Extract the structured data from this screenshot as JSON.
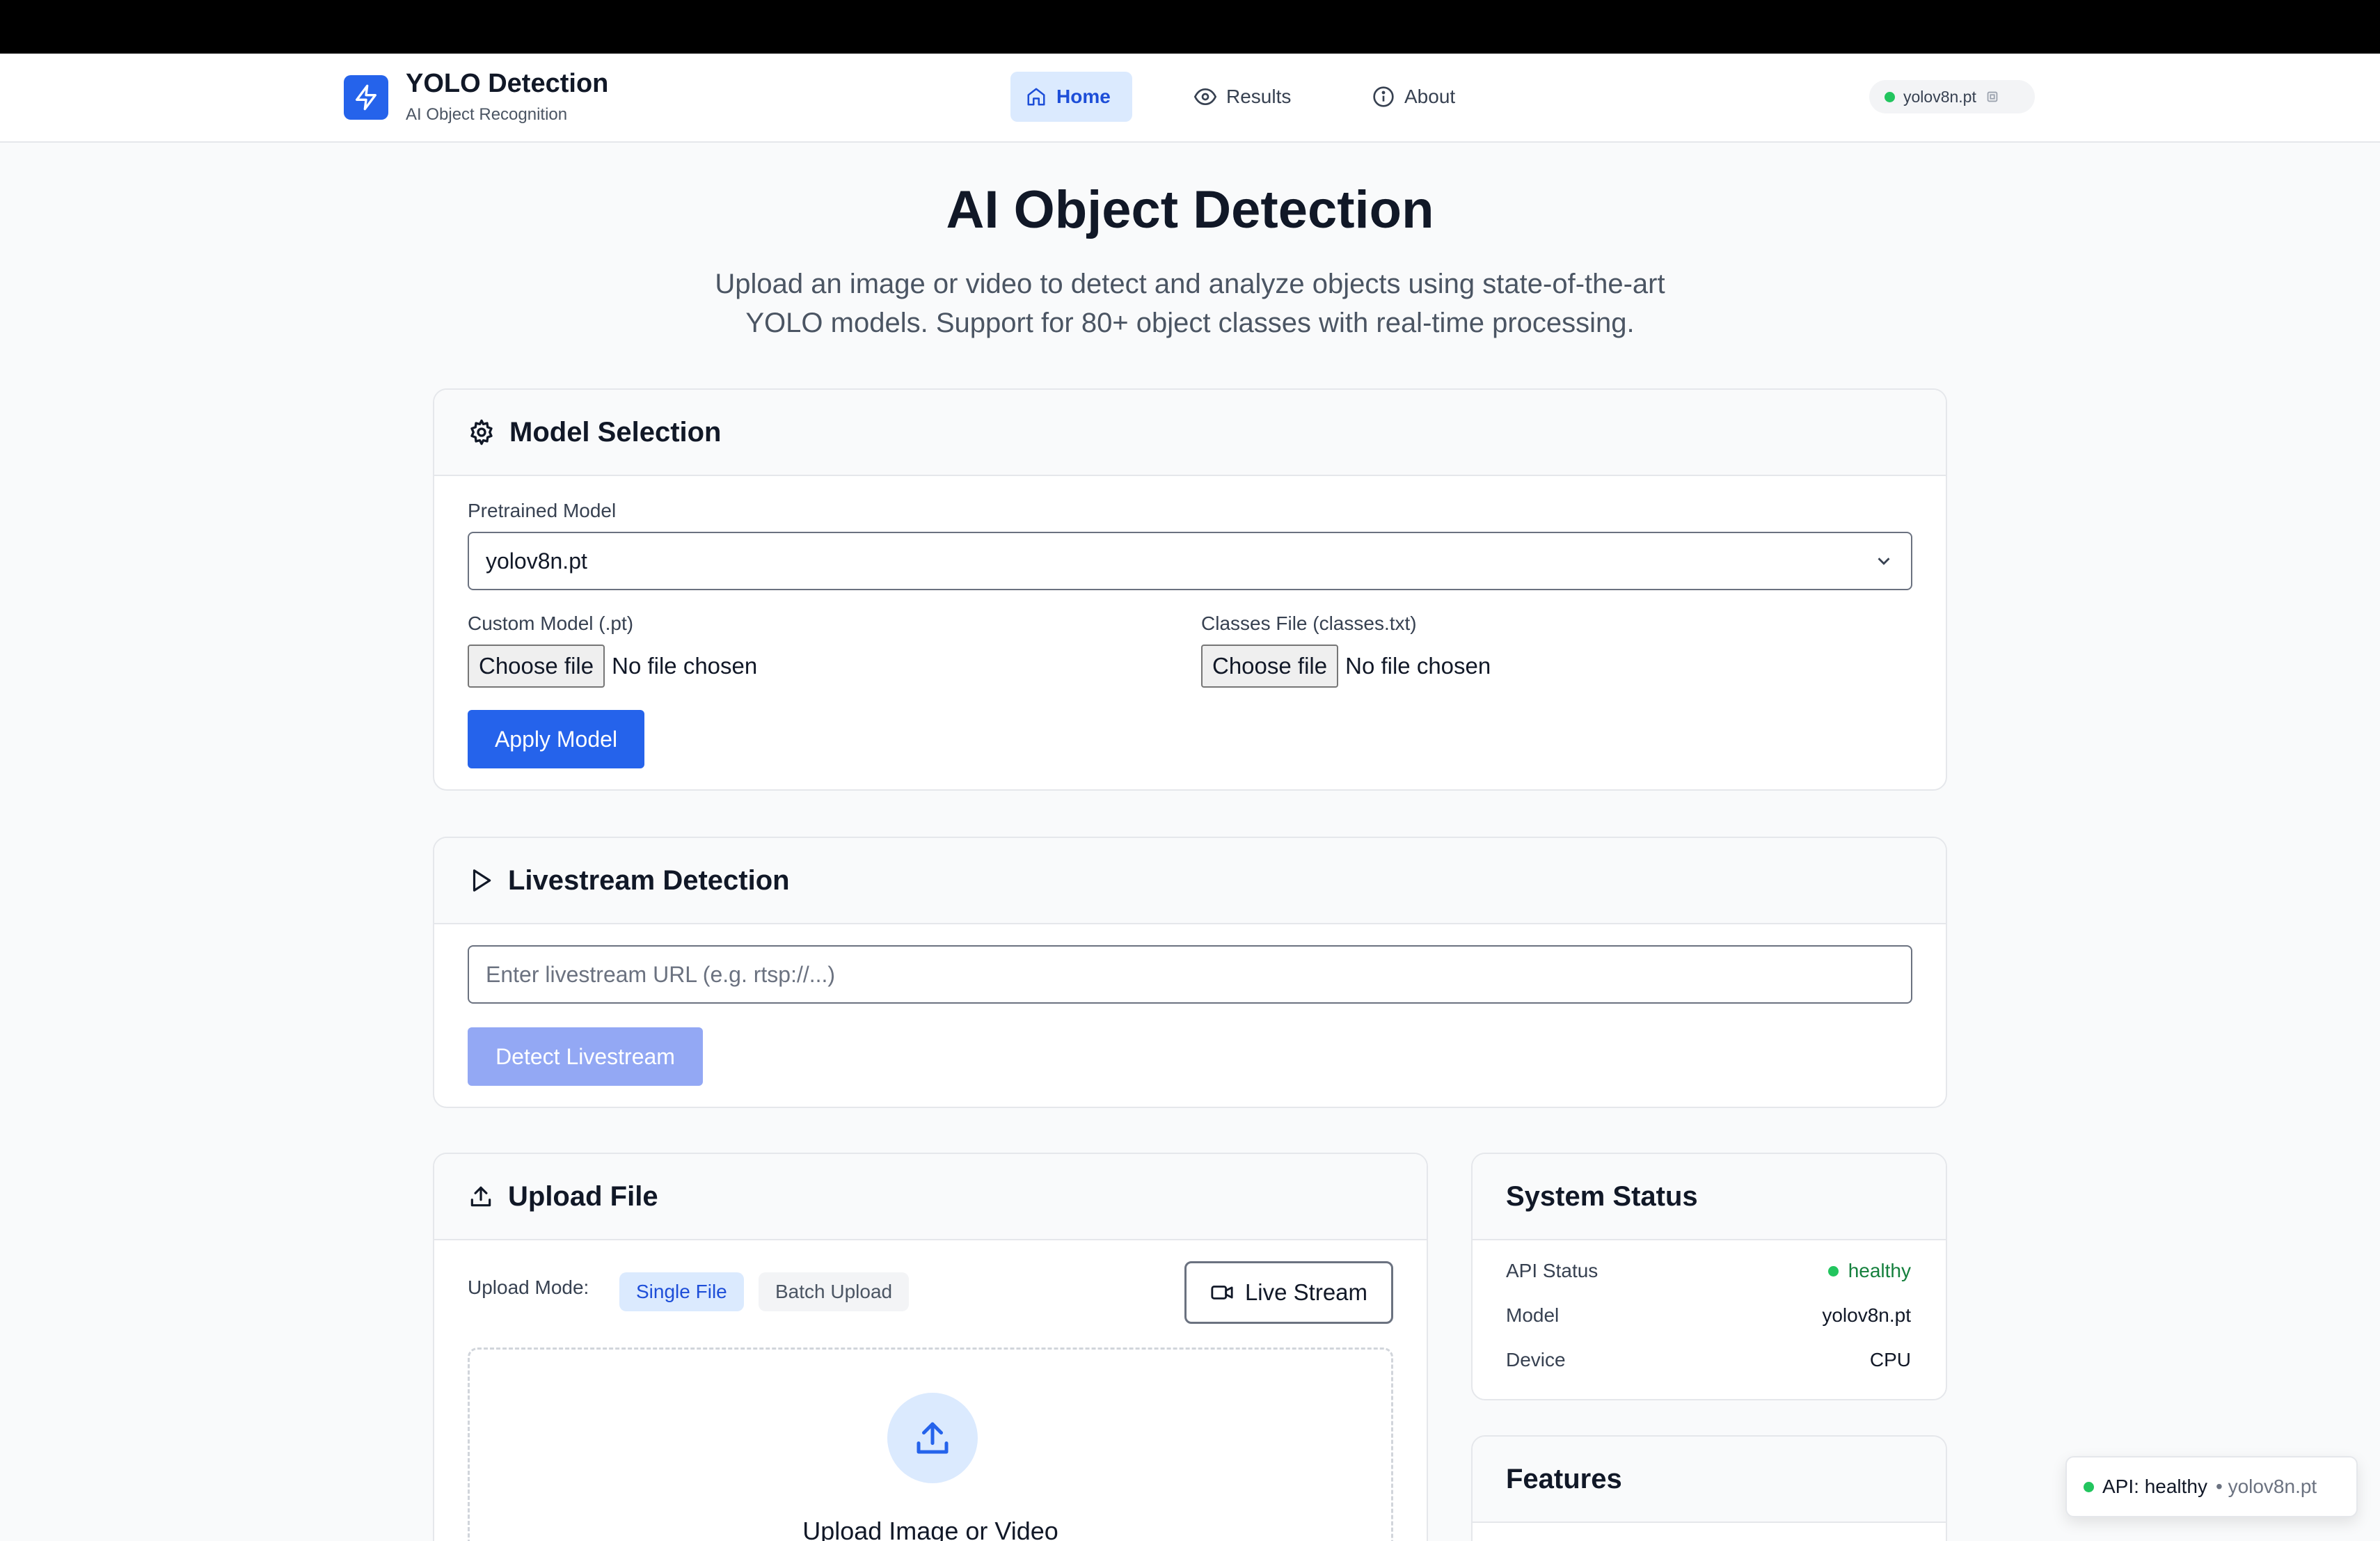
{
  "nav": {
    "brand_title": "YOLO Detection",
    "brand_subtitle": "AI Object Recognition",
    "items": [
      {
        "label": "Home",
        "icon": "home-icon",
        "active": true
      },
      {
        "label": "Results",
        "icon": "eye-icon",
        "active": false
      },
      {
        "label": "About",
        "icon": "info-icon",
        "active": false
      }
    ],
    "model_pill": "yolov8n.pt"
  },
  "hero": {
    "title": "AI Object Detection",
    "subtitle_line1": "Upload an image or video to detect and analyze objects using state-of-the-art",
    "subtitle_line2": "YOLO models. Support for 80+ object classes with real-time processing."
  },
  "model_selection": {
    "title": "Model Selection",
    "pretrained_label": "Pretrained Model",
    "pretrained_value": "yolov8n.pt",
    "custom_label": "Custom Model (.pt)",
    "classes_label": "Classes File (classes.txt)",
    "choose_file": "Choose file",
    "no_file": "No file chosen",
    "apply_button": "Apply Model"
  },
  "livestream": {
    "title": "Livestream Detection",
    "url_placeholder": "Enter livestream URL (e.g. rtsp://...)",
    "detect_button": "Detect Livestream"
  },
  "upload": {
    "title": "Upload File",
    "mode_label": "Upload Mode:",
    "mode_single": "Single File",
    "mode_batch": "Batch Upload",
    "live_stream_button": "Live Stream",
    "drop_title": "Upload Image or Video"
  },
  "system_status": {
    "title": "System Status",
    "rows": [
      {
        "label": "API Status",
        "value": "healthy"
      },
      {
        "label": "Model",
        "value": "yolov8n.pt"
      },
      {
        "label": "Device",
        "value": "CPU"
      }
    ]
  },
  "features": {
    "title": "Features"
  },
  "toast": {
    "api": "API: healthy",
    "model": "• yolov8n.pt"
  },
  "colors": {
    "primary": "#2563eb",
    "healthy": "#22c55e",
    "active_bg": "#dbeafe"
  }
}
